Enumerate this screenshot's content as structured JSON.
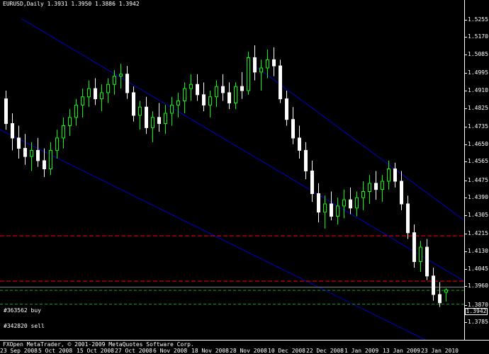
{
  "header": {
    "text": "EURUSD,Daily  1.3931 1.3950 1.3886 1.3942"
  },
  "price_axis": {
    "ticks": [
      "1.5255",
      "1.5170",
      "1.5085",
      "1.4995",
      "1.4910",
      "1.4825",
      "1.4735",
      "1.4650",
      "1.4565",
      "1.4475",
      "1.4390",
      "1.4305",
      "1.4215",
      "1.4130",
      "1.4045",
      "1.3960",
      "1.3870",
      "1.3785"
    ],
    "current_price": "1.3942"
  },
  "orders": [
    {
      "label": "#363562 buy",
      "price": 1.3942
    },
    {
      "label": "#342820 sell",
      "price": 1.3873
    }
  ],
  "levels": {
    "red1": 1.4205,
    "red2": 1.3985,
    "green_dashed": 1.394
  },
  "footer": {
    "copyright": "FXOpen MetaTrader, © 2001-2009 MetaQuotes Software Corp."
  },
  "time_axis": {
    "ticks": [
      "23 Sep 2008",
      "5 Oct 2008",
      "15 Oct 2008",
      "27 Oct 2008",
      "6 Nov 2008",
      "18 Nov 2008",
      "28 Nov 2008",
      "10 Dec 2008",
      "22 Dec 2008",
      "1 Jan 2009",
      "13 Jan 2009",
      "23 Jan 2010"
    ]
  },
  "colors": {
    "bull": "#00ff00",
    "bear": "#ffffff",
    "channel": "#0000c8",
    "red_line": "#ff0000",
    "order_line": "#00aa00"
  },
  "chart_data": {
    "type": "candlestick",
    "symbol": "EURUSD",
    "timeframe": "Daily",
    "ylim": [
      1.3785,
      1.5255
    ],
    "ohlc": [
      [
        1.487,
        1.491,
        1.472,
        1.475
      ],
      [
        1.475,
        1.48,
        1.462,
        1.468
      ],
      [
        1.468,
        1.474,
        1.458,
        1.463
      ],
      [
        1.463,
        1.47,
        1.455,
        1.459
      ],
      [
        1.459,
        1.466,
        1.452,
        1.462
      ],
      [
        1.462,
        1.468,
        1.454,
        1.457
      ],
      [
        1.457,
        1.463,
        1.449,
        1.453
      ],
      [
        1.453,
        1.466,
        1.45,
        1.462
      ],
      [
        1.462,
        1.472,
        1.458,
        1.468
      ],
      [
        1.468,
        1.478,
        1.463,
        1.474
      ],
      [
        1.474,
        1.482,
        1.469,
        1.478
      ],
      [
        1.478,
        1.487,
        1.474,
        1.484
      ],
      [
        1.484,
        1.492,
        1.478,
        1.488
      ],
      [
        1.488,
        1.496,
        1.483,
        1.492
      ],
      [
        1.492,
        1.497,
        1.484,
        1.487
      ],
      [
        1.487,
        1.494,
        1.481,
        1.49
      ],
      [
        1.49,
        1.497,
        1.485,
        1.494
      ],
      [
        1.494,
        1.501,
        1.489,
        1.498
      ],
      [
        1.498,
        1.504,
        1.492,
        1.499
      ],
      [
        1.499,
        1.503,
        1.487,
        1.49
      ],
      [
        1.49,
        1.493,
        1.476,
        1.479
      ],
      [
        1.479,
        1.486,
        1.472,
        1.483
      ],
      [
        1.483,
        1.488,
        1.47,
        1.473
      ],
      [
        1.473,
        1.481,
        1.466,
        1.478
      ],
      [
        1.478,
        1.485,
        1.471,
        1.475
      ],
      [
        1.475,
        1.484,
        1.47,
        1.48
      ],
      [
        1.48,
        1.488,
        1.474,
        1.484
      ],
      [
        1.484,
        1.49,
        1.478,
        1.486
      ],
      [
        1.486,
        1.495,
        1.48,
        1.492
      ],
      [
        1.492,
        1.499,
        1.486,
        1.494
      ],
      [
        1.494,
        1.499,
        1.486,
        1.489
      ],
      [
        1.489,
        1.495,
        1.481,
        1.484
      ],
      [
        1.484,
        1.491,
        1.478,
        1.488
      ],
      [
        1.488,
        1.496,
        1.483,
        1.493
      ],
      [
        1.493,
        1.499,
        1.486,
        1.49
      ],
      [
        1.49,
        1.495,
        1.482,
        1.485
      ],
      [
        1.485,
        1.495,
        1.482,
        1.493
      ],
      [
        1.493,
        1.5,
        1.487,
        1.491
      ],
      [
        1.491,
        1.51,
        1.489,
        1.507
      ],
      [
        1.507,
        1.513,
        1.496,
        1.5
      ],
      [
        1.5,
        1.506,
        1.491,
        1.502
      ],
      [
        1.502,
        1.511,
        1.497,
        1.506
      ],
      [
        1.506,
        1.512,
        1.498,
        1.503
      ],
      [
        1.503,
        1.506,
        1.485,
        1.487
      ],
      [
        1.487,
        1.491,
        1.474,
        1.477
      ],
      [
        1.477,
        1.483,
        1.465,
        1.468
      ],
      [
        1.468,
        1.474,
        1.458,
        1.462
      ],
      [
        1.462,
        1.466,
        1.448,
        1.452
      ],
      [
        1.452,
        1.457,
        1.437,
        1.441
      ],
      [
        1.441,
        1.446,
        1.427,
        1.432
      ],
      [
        1.432,
        1.44,
        1.424,
        1.436
      ],
      [
        1.436,
        1.442,
        1.428,
        1.43
      ],
      [
        1.43,
        1.439,
        1.426,
        1.435
      ],
      [
        1.435,
        1.443,
        1.429,
        1.438
      ],
      [
        1.438,
        1.444,
        1.431,
        1.434
      ],
      [
        1.434,
        1.442,
        1.43,
        1.439
      ],
      [
        1.439,
        1.447,
        1.433,
        1.442
      ],
      [
        1.442,
        1.45,
        1.436,
        1.446
      ],
      [
        1.446,
        1.452,
        1.438,
        1.443
      ],
      [
        1.443,
        1.45,
        1.437,
        1.447
      ],
      [
        1.447,
        1.457,
        1.443,
        1.453
      ],
      [
        1.453,
        1.456,
        1.444,
        1.447
      ],
      [
        1.447,
        1.452,
        1.433,
        1.436
      ],
      [
        1.436,
        1.44,
        1.419,
        1.422
      ],
      [
        1.422,
        1.426,
        1.405,
        1.408
      ],
      [
        1.408,
        1.418,
        1.403,
        1.415
      ],
      [
        1.415,
        1.419,
        1.399,
        1.401
      ],
      [
        1.401,
        1.405,
        1.389,
        1.392
      ],
      [
        1.392,
        1.398,
        1.386,
        1.388
      ],
      [
        1.3931,
        1.395,
        1.3886,
        1.3942
      ]
    ]
  }
}
